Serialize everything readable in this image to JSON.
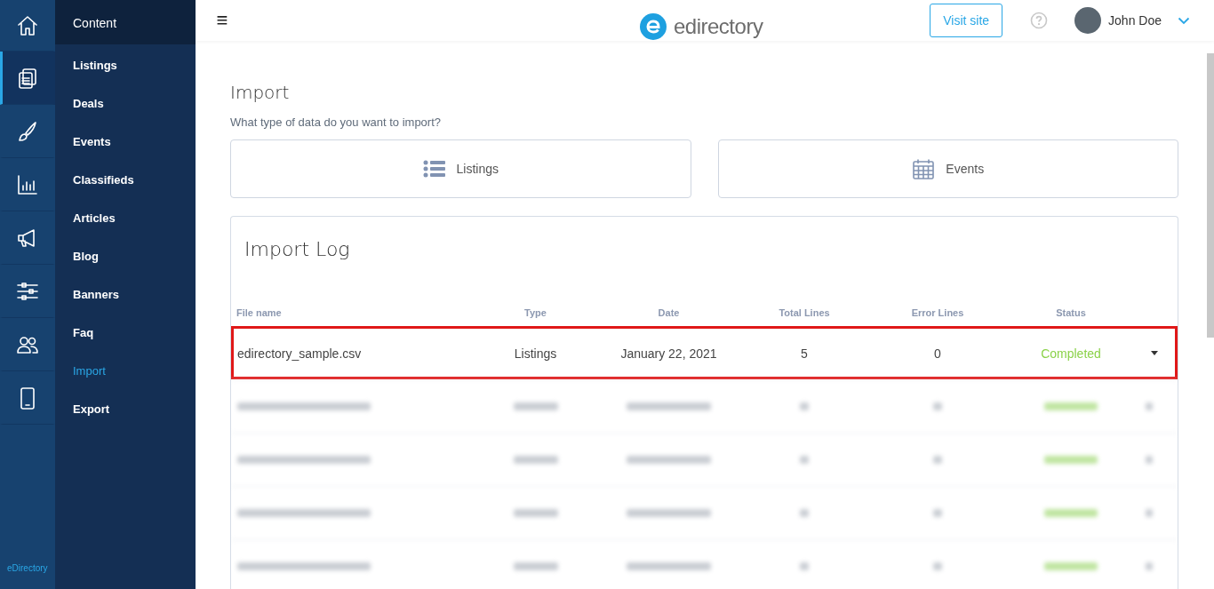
{
  "icon_rail": {
    "items": [
      {
        "kind": "home",
        "selected": false
      },
      {
        "kind": "content",
        "selected": true
      },
      {
        "kind": "design",
        "selected": false
      },
      {
        "kind": "reports",
        "selected": false
      },
      {
        "kind": "promote",
        "selected": false
      },
      {
        "kind": "settings",
        "selected": false
      },
      {
        "kind": "users",
        "selected": false
      },
      {
        "kind": "mobile",
        "selected": false
      }
    ],
    "footer": "eDirectory"
  },
  "menu": {
    "heading": "Content",
    "items": [
      {
        "label": "Listings",
        "selected": false
      },
      {
        "label": "Deals",
        "selected": false
      },
      {
        "label": "Events",
        "selected": false
      },
      {
        "label": "Classifieds",
        "selected": false
      },
      {
        "label": "Articles",
        "selected": false
      },
      {
        "label": "Blog",
        "selected": false
      },
      {
        "label": "Banners",
        "selected": false
      },
      {
        "label": "Faq",
        "selected": false
      },
      {
        "label": "Import",
        "selected": true
      },
      {
        "label": "Export",
        "selected": false
      }
    ]
  },
  "header": {
    "menu_glyph": "≡",
    "brand": "edirectory",
    "visit_button": "Visit site",
    "user_name": "John Doe"
  },
  "import": {
    "title": "Import",
    "question": "What type of data do you want to import?",
    "options": [
      {
        "kind": "listings",
        "label": "Listings"
      },
      {
        "kind": "events",
        "label": "Events"
      }
    ]
  },
  "import_log": {
    "title": "Import Log",
    "columns": [
      "File name",
      "Type",
      "Date",
      "Total Lines",
      "Error Lines",
      "Status"
    ],
    "rows": [
      {
        "file": "edirectory_sample.csv",
        "type": "Listings",
        "date": "January 22, 2021",
        "total": "5",
        "errors": "0",
        "status": "Completed",
        "highlighted": true
      }
    ]
  }
}
